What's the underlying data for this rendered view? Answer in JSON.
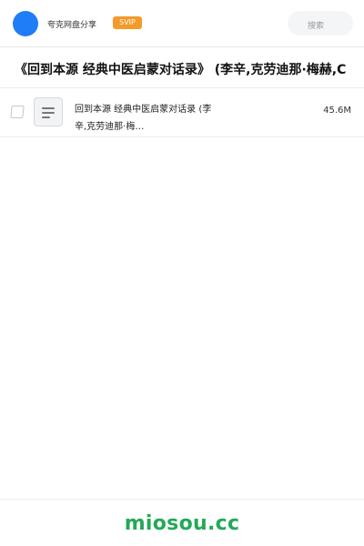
{
  "header": {
    "app_name": "夸克网盘分享",
    "badge": "SVIP",
    "search_placeholder": "搜索",
    "avatar_color": "#1f7df6",
    "badge_color": "#f39a2b"
  },
  "title": "《回到本源 经典中医启蒙对话录》 (李辛,克劳迪那·梅赫,C",
  "files": [
    {
      "name": "回到本源 经典中医启蒙对话录 (李辛,克劳迪那·梅…",
      "size": "45.6M",
      "icon": "document-icon"
    }
  ],
  "footer": {
    "brand": "miosou.cc",
    "brand_color": "#23a957"
  }
}
